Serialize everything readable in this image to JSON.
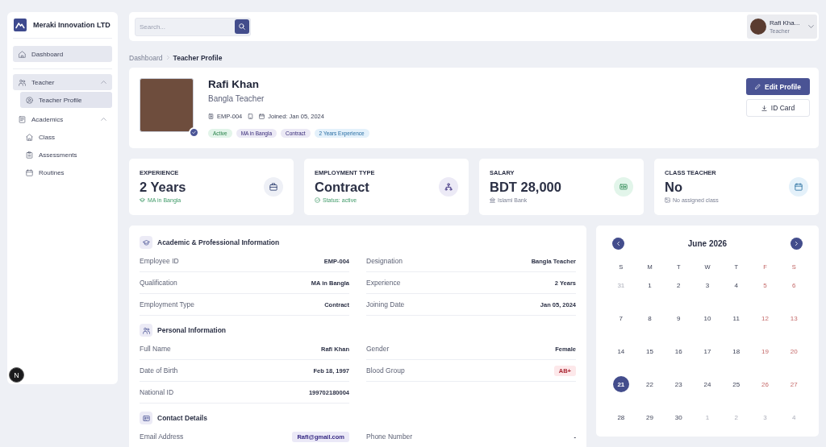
{
  "sidebar": {
    "brand": "Meraki Innovation LTD",
    "sections": [
      {
        "items": [
          {
            "label": "Dashboard",
            "selected": true
          }
        ]
      },
      {
        "items": [
          {
            "label": "Teacher",
            "selected": true,
            "expanded": true,
            "children": [
              {
                "label": "Teacher Profile",
                "selected": true
              }
            ]
          },
          {
            "label": "Academics",
            "selected": false,
            "expanded": true,
            "children": [
              {
                "label": "Class",
                "selected": false
              },
              {
                "label": "Assessments",
                "selected": false
              },
              {
                "label": "Routines",
                "selected": false
              }
            ]
          }
        ]
      }
    ]
  },
  "dev_badge": {
    "label": "N"
  },
  "header": {
    "search": {
      "placeholder": "Search..."
    },
    "user": {
      "name": "Rafi Kha...",
      "role": "Teacher"
    }
  },
  "breadcrumb": [
    {
      "label": "Dashboard",
      "current": false
    },
    {
      "label": "Teacher Profile",
      "current": true
    }
  ],
  "profile": {
    "name": "Rafi Khan",
    "title": "Bangla Teacher",
    "verified": true,
    "meta": [
      {
        "kind": "id",
        "text": "EMP-004"
      },
      {
        "kind": "phone"
      },
      {
        "kind": "joined",
        "text": "Joined: Jan 05, 2024"
      }
    ],
    "tags": [
      {
        "label": "Active",
        "color": "#e2f4e9"
      },
      {
        "label": "MA in Bangla",
        "color": "#ebe9f5"
      },
      {
        "label": "Contract",
        "color": "#ebe9f5"
      },
      {
        "label": "2 Years Experience",
        "color": "#e4f1fb"
      }
    ],
    "actions": [
      {
        "label": "Edit Profile",
        "kind": "primary"
      },
      {
        "label": "ID Card",
        "kind": "secondary"
      }
    ]
  },
  "stats": [
    {
      "label": "EXPERIENCE",
      "value": "2 Years",
      "note": "MA in Bangla",
      "highlight": true,
      "color": "#eef0f6"
    },
    {
      "label": "EMPLOYMENT TYPE",
      "value": "Contract",
      "note": "Status: active",
      "highlight": true,
      "color": "#eceaf6"
    },
    {
      "label": "SALARY",
      "value": "BDT 28,000",
      "note": "Islami Bank",
      "highlight": false,
      "color": "#e2f5ea"
    },
    {
      "label": "CLASS TEACHER",
      "value": "No",
      "note": "No assigned class",
      "highlight": false,
      "color": "#e4f1fa"
    }
  ],
  "info_sections": [
    {
      "title": "Academic & Professional Information",
      "fields": [
        {
          "label": "Employee ID",
          "value": "EMP-004"
        },
        {
          "label": "Designation",
          "value": "Bangla Teacher"
        },
        {
          "label": "Qualification",
          "value": "MA in Bangla"
        },
        {
          "label": "Experience",
          "value": "2 Years"
        },
        {
          "label": "Employment Type",
          "value": "Contract"
        },
        {
          "label": "Joining Date",
          "value": "Jan 05, 2024"
        }
      ]
    },
    {
      "title": "Personal Information",
      "fields": [
        {
          "label": "Full Name",
          "value": "Rafi Khan"
        },
        {
          "label": "Gender",
          "value": "Female"
        },
        {
          "label": "Date of Birth",
          "value": "Feb 18, 1997"
        },
        {
          "label": "Blood Group",
          "value": "AB+",
          "color": "#fde8ea"
        },
        {
          "label": "National ID",
          "value": "199702180004"
        }
      ]
    },
    {
      "title": "Contact Details",
      "fields": [
        {
          "label": "Email Address",
          "value": "Rafi@gmail.com",
          "color": "#ebe9f7"
        },
        {
          "label": "Phone Number",
          "value": "-"
        }
      ]
    }
  ],
  "calendar": {
    "month": "June 2026",
    "weekdays": [
      {
        "label": "S",
        "weekend": false
      },
      {
        "label": "M",
        "weekend": false
      },
      {
        "label": "T",
        "weekend": false
      },
      {
        "label": "W",
        "weekend": false
      },
      {
        "label": "T",
        "weekend": false
      },
      {
        "label": "F",
        "weekend": true
      },
      {
        "label": "S",
        "weekend": true
      }
    ],
    "weeks": [
      [
        {
          "day": "31",
          "outside": true,
          "selected": false
        },
        {
          "day": "1",
          "outside": false,
          "selected": false
        },
        {
          "day": "2",
          "outside": false,
          "selected": false
        },
        {
          "day": "3",
          "outside": false,
          "selected": false
        },
        {
          "day": "4",
          "outside": false,
          "selected": false
        },
        {
          "day": "5",
          "outside": false,
          "selected": false
        },
        {
          "day": "6",
          "outside": false,
          "selected": false
        }
      ],
      [
        {
          "day": "7",
          "outside": false,
          "selected": false
        },
        {
          "day": "8",
          "outside": false,
          "selected": false
        },
        {
          "day": "9",
          "outside": false,
          "selected": false
        },
        {
          "day": "10",
          "outside": false,
          "selected": false
        },
        {
          "day": "11",
          "outside": false,
          "selected": false
        },
        {
          "day": "12",
          "outside": false,
          "selected": false
        },
        {
          "day": "13",
          "outside": false,
          "selected": false
        }
      ],
      [
        {
          "day": "14",
          "outside": false,
          "selected": false
        },
        {
          "day": "15",
          "outside": false,
          "selected": false
        },
        {
          "day": "16",
          "outside": false,
          "selected": false
        },
        {
          "day": "17",
          "outside": false,
          "selected": false
        },
        {
          "day": "18",
          "outside": false,
          "selected": false
        },
        {
          "day": "19",
          "outside": false,
          "selected": false
        },
        {
          "day": "20",
          "outside": false,
          "selected": false
        }
      ],
      [
        {
          "day": "21",
          "outside": false,
          "selected": true
        },
        {
          "day": "22",
          "outside": false,
          "selected": false
        },
        {
          "day": "23",
          "outside": false,
          "selected": false
        },
        {
          "day": "24",
          "outside": false,
          "selected": false
        },
        {
          "day": "25",
          "outside": false,
          "selected": false
        },
        {
          "day": "26",
          "outside": false,
          "selected": false
        },
        {
          "day": "27",
          "outside": false,
          "selected": false
        }
      ],
      [
        {
          "day": "28",
          "outside": false,
          "selected": false
        },
        {
          "day": "29",
          "outside": false,
          "selected": false
        },
        {
          "day": "30",
          "outside": false,
          "selected": false
        },
        {
          "day": "1",
          "outside": true,
          "selected": false
        },
        {
          "day": "2",
          "outside": true,
          "selected": false
        },
        {
          "day": "3",
          "outside": true,
          "selected": false
        },
        {
          "day": "4",
          "outside": true,
          "selected": false
        }
      ]
    ]
  }
}
